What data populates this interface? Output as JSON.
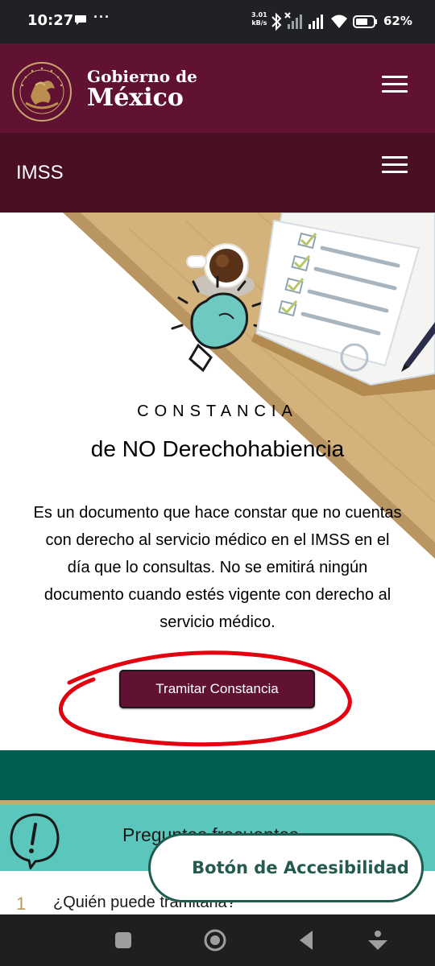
{
  "status_bar": {
    "time": "10:27",
    "more": "···",
    "net_speed_value": "3.01",
    "net_speed_unit": "kB/s",
    "battery": "62%"
  },
  "gobierno": {
    "line1": "Gobierno de",
    "line2": "México",
    "seal_text": "ESTADOS UNIDOS MEXICANOS",
    "menu_icon": "hamburger-icon"
  },
  "imss": {
    "label": "IMSS",
    "menu_icon": "hamburger-icon"
  },
  "hero": {
    "eyebrow": "CONSTANCIA",
    "title": "de NO Derechohabiencia",
    "description": "Es un documento que hace constar que no cuentas con derecho al servicio médico en el IMSS en el día que lo consultas. No se emitirá ningún documento cuando estés vigente con derecho al servicio médico.",
    "button_label": "Tramitar Constancia"
  },
  "faq": {
    "title": "Preguntas frecuentes",
    "items": [
      {
        "number": "1",
        "question": "¿Quién puede tramitarla?"
      }
    ]
  },
  "accessibility_button": "Botón de Accesibilidad",
  "colors": {
    "guinda": "#611232",
    "guinda_dark": "#4a0f25",
    "green": "#005f4f",
    "teal": "#5bc6bc",
    "gold": "#c8a96b",
    "scribble_red": "#e3000f"
  }
}
